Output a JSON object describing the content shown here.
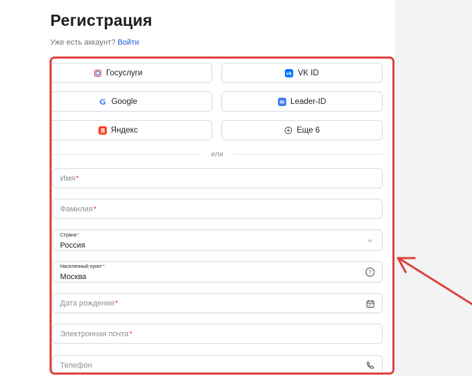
{
  "page": {
    "title": "Регистрация"
  },
  "login": {
    "prompt": "Уже есть аккаунт?",
    "link": "Войти"
  },
  "social": [
    {
      "label": "Госуслуги",
      "icon": "gosuslugi-icon"
    },
    {
      "label": "VK ID",
      "icon": "vk-icon"
    },
    {
      "label": "Google",
      "icon": "google-icon"
    },
    {
      "label": "Leader-ID",
      "icon": "leader-id-icon"
    },
    {
      "label": "Яндекс",
      "icon": "yandex-icon"
    },
    {
      "label": "Еще 6",
      "icon": "plus-circle-icon"
    }
  ],
  "divider_text": "или",
  "fields": {
    "first_name": {
      "placeholder": "Имя",
      "required": "*"
    },
    "last_name": {
      "placeholder": "Фамилия",
      "required": "*"
    },
    "country": {
      "label": "Страна",
      "required": "*",
      "value": "Россия"
    },
    "city": {
      "label": "Населенный пункт",
      "required": "*",
      "value": "Москва"
    },
    "birth_date": {
      "placeholder": "Дата рождения",
      "required": "*"
    },
    "email": {
      "placeholder": "Электронная почта",
      "required": "*"
    },
    "phone": {
      "placeholder": "Телефон"
    }
  },
  "colors": {
    "highlight": "#e0413a",
    "link": "#1b5fd6",
    "vk": "#0077ff",
    "leader": "#3f7cf0",
    "yandex": "#fc3f1d"
  }
}
